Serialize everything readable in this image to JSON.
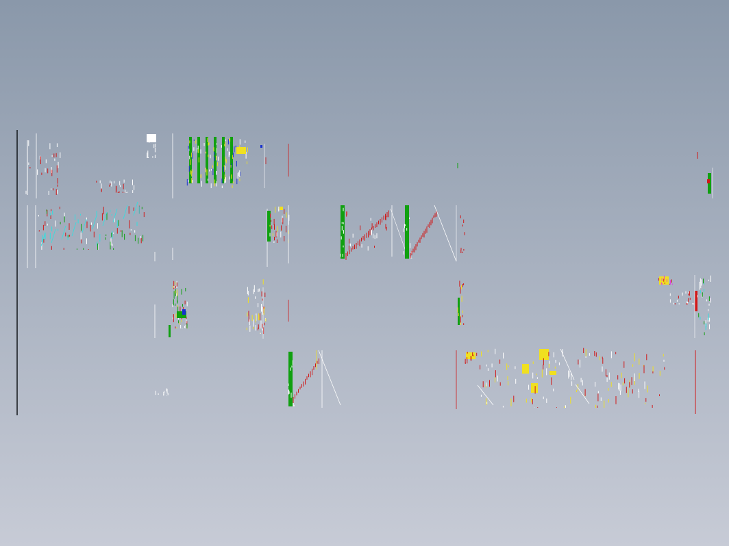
{
  "viewport": {
    "background_top": "#8A98AA",
    "background_bottom": "#C7CBD6"
  },
  "palette": {
    "white": "#FFFFFF",
    "green": "#10A010",
    "red": "#D01818",
    "yellow": "#F0E020",
    "cyan": "#30E0E0",
    "blue": "#1830D0",
    "magenta": "#E040E0",
    "border": "#101418"
  }
}
